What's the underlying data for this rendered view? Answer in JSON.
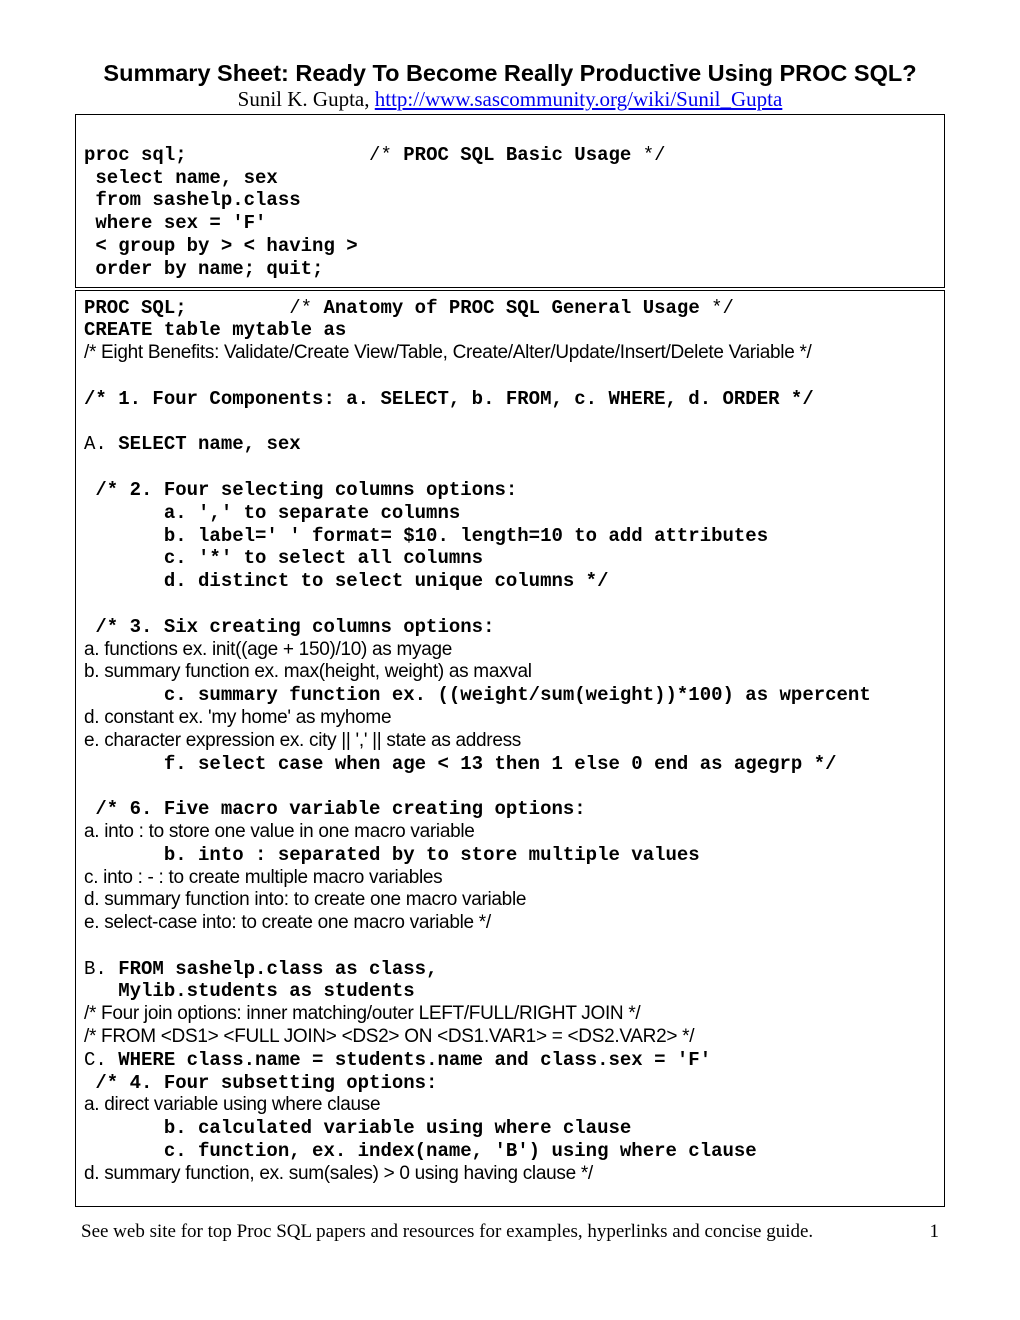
{
  "title": "Summary Sheet: Ready To Become Really Productive Using PROC SQL?",
  "author": "Sunil K. Gupta, ",
  "url": "http://www.sascommunity.org/wiki/Sunil_Gupta",
  "box1": {
    "l1a": "proc sql;",
    "l1b": "                /* ",
    "l1c": "PROC SQL Basic Usage",
    "l1d": " */",
    "l2": " select name, sex",
    "l3": " from sashelp.class",
    "l4": " where sex = 'F'",
    "l5": " < group by > < having > ",
    "l6": " order by name; quit;"
  },
  "box2": {
    "l1a": "PROC SQL;",
    "l1b": "         /* ",
    "l1c": "Anatomy of PROC SQL General Usage",
    "l1d": " */",
    "l2": "CREATE table mytable as",
    "l3": "/* Eight Benefits: Validate/Create View/Table, Create/Alter/Update/Insert/Delete Variable */",
    "l5": "/* 1. Four Components: a. SELECT, b. FROM, c. WHERE, d. ORDER */",
    "l7pre": "A.",
    "l7b": " SELECT name, sex",
    "sel1": " /* 2. Four selecting columns options:",
    "sel2": "       a. ',' to separate columns",
    "sel3": "       b. label=' ' format= $10. length=10 to add attributes",
    "sel4": "       c. '*' to select all columns",
    "sel5": "       d. distinct to select unique columns */",
    "cr1": " /* 3. Six creating columns options:",
    "cr2": "     a. functions ex. init((age + 150)/10) as myage",
    "cr3": "     b. summary function ex. max(height, weight) as maxval",
    "cr4": "       c. summary function ex. ((weight/sum(weight))*100) as wpercent",
    "cr5": "     d. constant ex. 'my home' as myhome",
    "cr6": "     e. character expression ex. city || ',' || state as address",
    "cr7": "       f. select case when age < 13 then 1 else 0 end as agegrp */",
    "mv1": " /* 6. Five macro variable creating options:  ",
    "mv2": "     a. into : to store one value in one macro variable",
    "mv3": "       b. into : separated by to store multiple values",
    "mv4": "     c. into : - : to create multiple macro variables",
    "mv5": "     d. summary function into: to create one macro variable",
    "mv6": "     e. select-case into:  to create one macro variable */",
    "bpre": "B.",
    "b1": " FROM sashelp.class as class, ",
    "b2": "   Mylib.students as students",
    "bj1": " /* Four join options: inner matching/outer LEFT/FULL/RIGHT JOIN */",
    "bj2": "  /* FROM <DS1> <FULL JOIN> <DS2>  ON <DS1.VAR1> = <DS2.VAR2> */",
    "cpre": "C.",
    "c1": " WHERE class.name = students.name and class.sex = 'F'",
    "sub1": " /* 4. Four subsetting options:",
    "sub2": "     a. direct variable using where clause",
    "sub3": "       b. calculated variable using where clause",
    "sub4": "       c. function, ex. index(name, 'B') using where clause",
    "sub5": "     d. summary function, ex. sum(sales) > 0 using having clause */"
  },
  "footer": {
    "text": "See web site for top Proc SQL papers and resources for examples, hyperlinks and concise guide.",
    "page": "1"
  }
}
